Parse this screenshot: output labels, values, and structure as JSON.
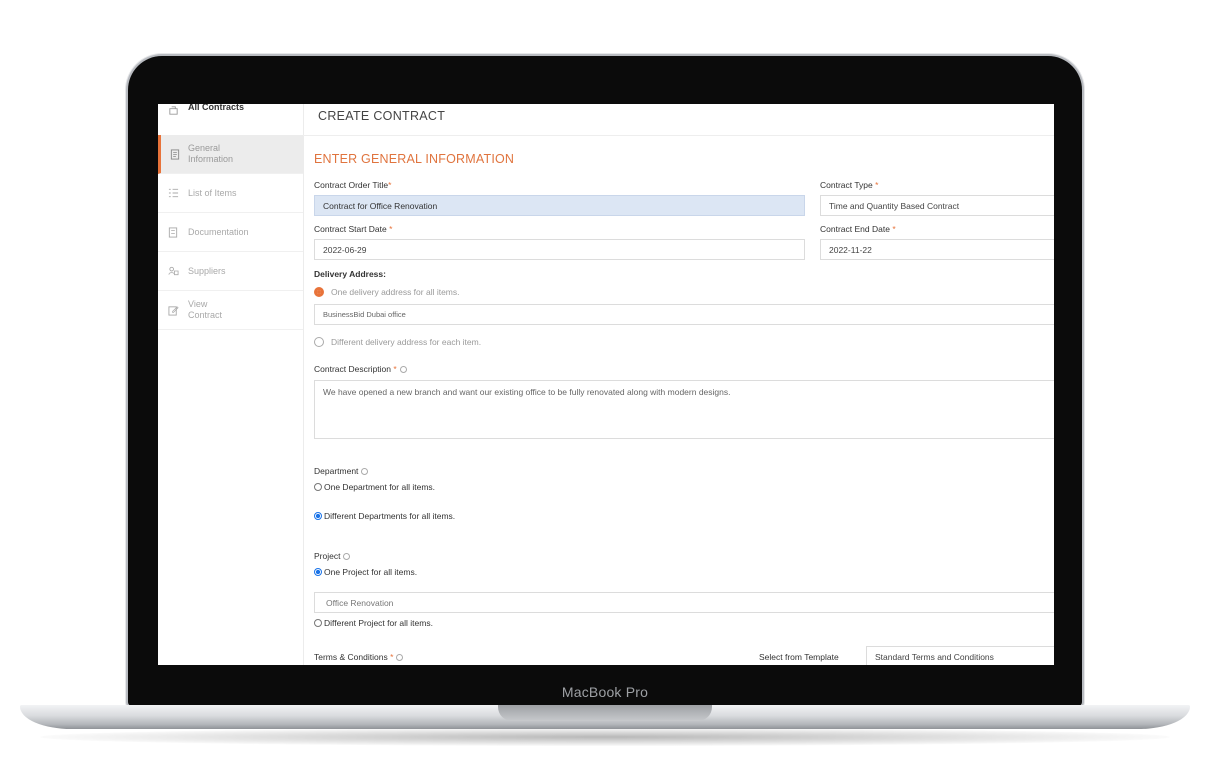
{
  "device": {
    "label": "MacBook Pro"
  },
  "sidebar": {
    "items": [
      {
        "label": "All Contracts",
        "icon": "contracts-icon"
      },
      {
        "label": "General Information",
        "icon": "document-icon",
        "active": true
      },
      {
        "label": "List of Items",
        "icon": "list-icon"
      },
      {
        "label": "Documentation",
        "icon": "documentation-icon"
      },
      {
        "label": "Suppliers",
        "icon": "suppliers-icon"
      },
      {
        "label": "View Contract",
        "icon": "edit-icon"
      }
    ]
  },
  "main": {
    "page_title": "CREATE CONTRACT",
    "section_title": "ENTER GENERAL INFORMATION",
    "contract_order_title": {
      "label": "Contract Order Title",
      "value": "Contract for Office Renovation"
    },
    "contract_type": {
      "label": "Contract Type",
      "value": "Time and Quantity Based Contract"
    },
    "contract_start_date": {
      "label": "Contract Start Date",
      "value": "2022-06-29"
    },
    "contract_end_date": {
      "label": "Contract End Date",
      "value": "2022-11-22"
    },
    "delivery": {
      "label": "Delivery Address:",
      "option_one": "One delivery address for all items.",
      "address_value": "BusinessBid Dubai office",
      "option_different": "Different delivery address for each item."
    },
    "description": {
      "label": "Contract Description",
      "value": "We have opened a new branch and want our existing office to be fully renovated along with modern designs."
    },
    "department": {
      "label": "Department",
      "option_one": "One Department for all items.",
      "option_different": "Different Departments for all items."
    },
    "project": {
      "label": "Project",
      "option_one": "One Project for all items.",
      "project_value": "Office Renovation",
      "option_different": "Different Project for all items."
    },
    "terms": {
      "label": "Terms & Conditions",
      "template_label": "Select from Template",
      "template_value": "Standard Terms and Conditions"
    }
  },
  "colors": {
    "accent": "#e8733a",
    "radio_selected": "#1a73e8",
    "highlight_field": "#dce6f4"
  }
}
